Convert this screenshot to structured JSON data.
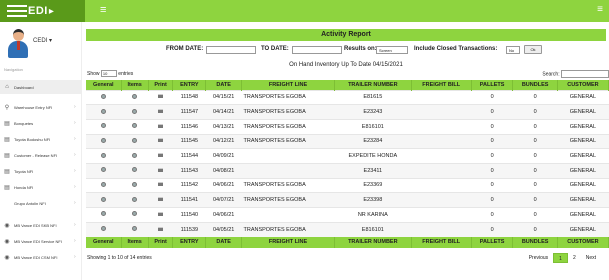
{
  "brand": {
    "name": "EDI",
    "arrow": "▸"
  },
  "header": {
    "menu_icon": "hamburger-icon",
    "right_icon": "≡"
  },
  "user": {
    "name": "CEDI ▾"
  },
  "nav": {
    "header": "Navigation",
    "items": [
      {
        "label": "Dashboard",
        "icon": "⌂"
      },
      {
        "label": "Warehouse Entry NFI",
        "icon": "⚲"
      },
      {
        "label": "Bonquetes",
        "icon": "▤"
      },
      {
        "label": "Toyota Bodoshu NFI",
        "icon": "▤"
      },
      {
        "label": "Customer - Release NFI",
        "icon": "▤"
      },
      {
        "label": "Toyota NFI",
        "icon": "▤"
      },
      {
        "label": "Honda NFI",
        "icon": "▤"
      },
      {
        "label": "Grupo Antolin NFI",
        "icon": ""
      },
      {
        "label": "MB Vance EDI SKB NFI",
        "icon": "◉"
      },
      {
        "label": "MB Vance EDI Service NFI",
        "icon": "◉"
      },
      {
        "label": "MB Vance EDI CSM NFI",
        "icon": "◉"
      }
    ]
  },
  "report": {
    "title": "Activity Report",
    "from_label": "FROM DATE:",
    "to_label": "TO DATE:",
    "results_label": "Results on:",
    "results_value": "Screen",
    "closed_label": "Include Closed Transactions:",
    "closed_value": "No",
    "ok_label": "Ok",
    "onhand": "On Hand Inventory Up To Date 04/15/2021",
    "show_label": "Show",
    "show_value": "10",
    "entries_label": "entries",
    "search_label": "Search:"
  },
  "table": {
    "columns": [
      "General",
      "Items",
      "Print",
      "ENTRY",
      "DATE",
      "FREIGHT LINE",
      "TRAILER NUMBER",
      "FREIGHT BILL",
      "PALLETS",
      "BUNDLES",
      "CUSTOMER"
    ],
    "rows": [
      [
        "111548",
        "04/15/21",
        "TRANSPORTES EGOBA",
        "E81615",
        "",
        "0",
        "0",
        "GENERAL"
      ],
      [
        "111547",
        "04/14/21",
        "TRANSPORTES EGOBA",
        "E23243",
        "",
        "0",
        "0",
        "GENERAL"
      ],
      [
        "111546",
        "04/13/21",
        "TRANSPORTES EGOBA",
        "E816101",
        "",
        "0",
        "0",
        "GENERAL"
      ],
      [
        "111545",
        "04/12/21",
        "TRANSPORTES EGOBA",
        "E23284",
        "",
        "0",
        "0",
        "GENERAL"
      ],
      [
        "111544",
        "04/09/21",
        "",
        "EXPEDITE HONDA",
        "",
        "0",
        "0",
        "GENERAL"
      ],
      [
        "111543",
        "04/08/21",
        "",
        "E23411",
        "",
        "0",
        "0",
        "GENERAL"
      ],
      [
        "111542",
        "04/06/21",
        "TRANSPORTES EGOBA",
        "E23369",
        "",
        "0",
        "0",
        "GENERAL"
      ],
      [
        "111541",
        "04/07/21",
        "TRANSPORTES EGOBA",
        "E23398",
        "",
        "0",
        "0",
        "GENERAL"
      ],
      [
        "111540",
        "04/06/21",
        "",
        "NR KARINA",
        "",
        "0",
        "0",
        "GENERAL"
      ],
      [
        "111539",
        "04/05/21",
        "TRANSPORTES EGOBA",
        "E816101",
        "",
        "0",
        "0",
        "GENERAL"
      ]
    ]
  },
  "footer": {
    "info": "Showing 1 to 10 of 14 entries",
    "previous": "Previous",
    "pages": [
      "1",
      "2"
    ],
    "next": "Next"
  }
}
